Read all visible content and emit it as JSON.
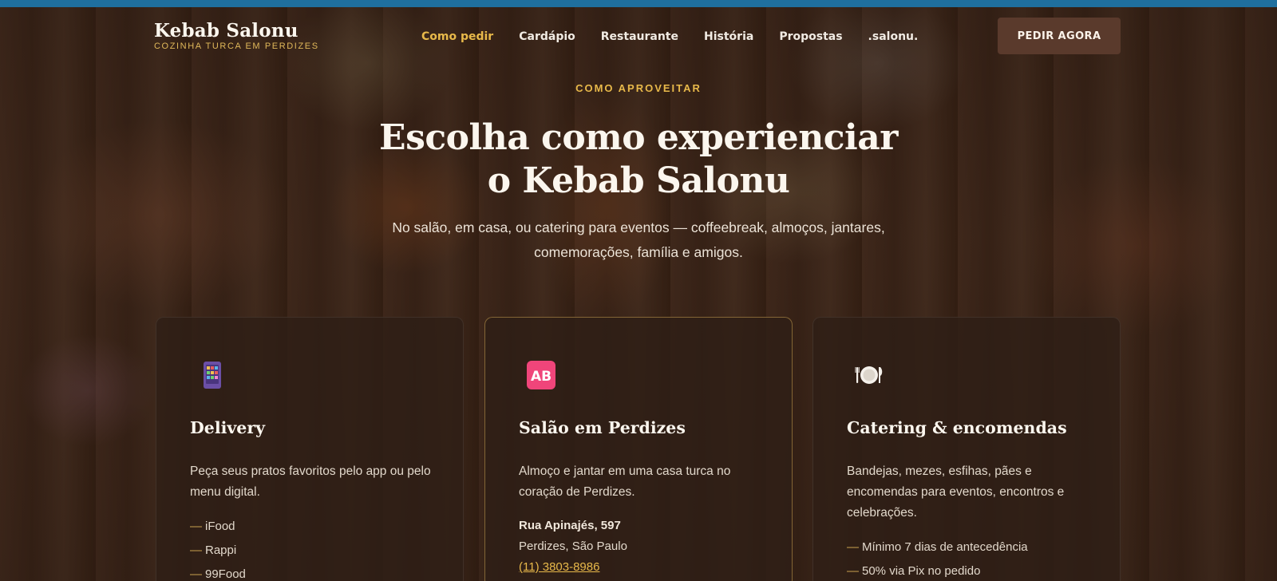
{
  "brand": {
    "name": "Kebab Salonu",
    "tagline": "COZINHA TURCA EM PERDIZES"
  },
  "nav": {
    "items": [
      "Como pedir",
      "Cardápio",
      "Restaurante",
      "História",
      "Propostas",
      ".salonu."
    ],
    "active": "Como pedir"
  },
  "cta": {
    "label": "PEDIR AGORA"
  },
  "hero": {
    "eyebrow": "COMO APROVEITAR",
    "title_line1": "Escolha como experienciar",
    "title_line2": "o Kebab Salonu",
    "subtitle_line1": "No salão, em casa, ou catering para eventos — coffeebreak, almoços, jantares,",
    "subtitle_line2": "comemorações, família e amigos."
  },
  "cards": [
    {
      "icon": "phone-app-icon",
      "title": "Delivery",
      "text": "Peça seus pratos favoritos pelo app ou pelo menu digital.",
      "list": [
        "iFood",
        "Rappi",
        "99Food"
      ]
    },
    {
      "icon": "ab-badge-icon",
      "icon_text": "AB",
      "title": "Salão em Perdizes",
      "text": "Almoço e jantar em uma casa turca no coração de Perdizes.",
      "address": "Rua Apinajés, 597",
      "city": "Perdizes, São Paulo",
      "phone": "(11) 3803-8986"
    },
    {
      "icon": "plate-cutlery-icon",
      "title": "Catering & encomendas",
      "text": "Bandejas, mezes, esfihas, pães e encomendas para eventos, encontros e celebrações.",
      "list": [
        "Mínimo 7 dias de antecedência",
        "50% via Pix no pedido"
      ]
    }
  ],
  "colors": {
    "accent": "#e8b94a",
    "cta_bg": "#5a3a2c",
    "top_strip": "#1f6f9e"
  }
}
